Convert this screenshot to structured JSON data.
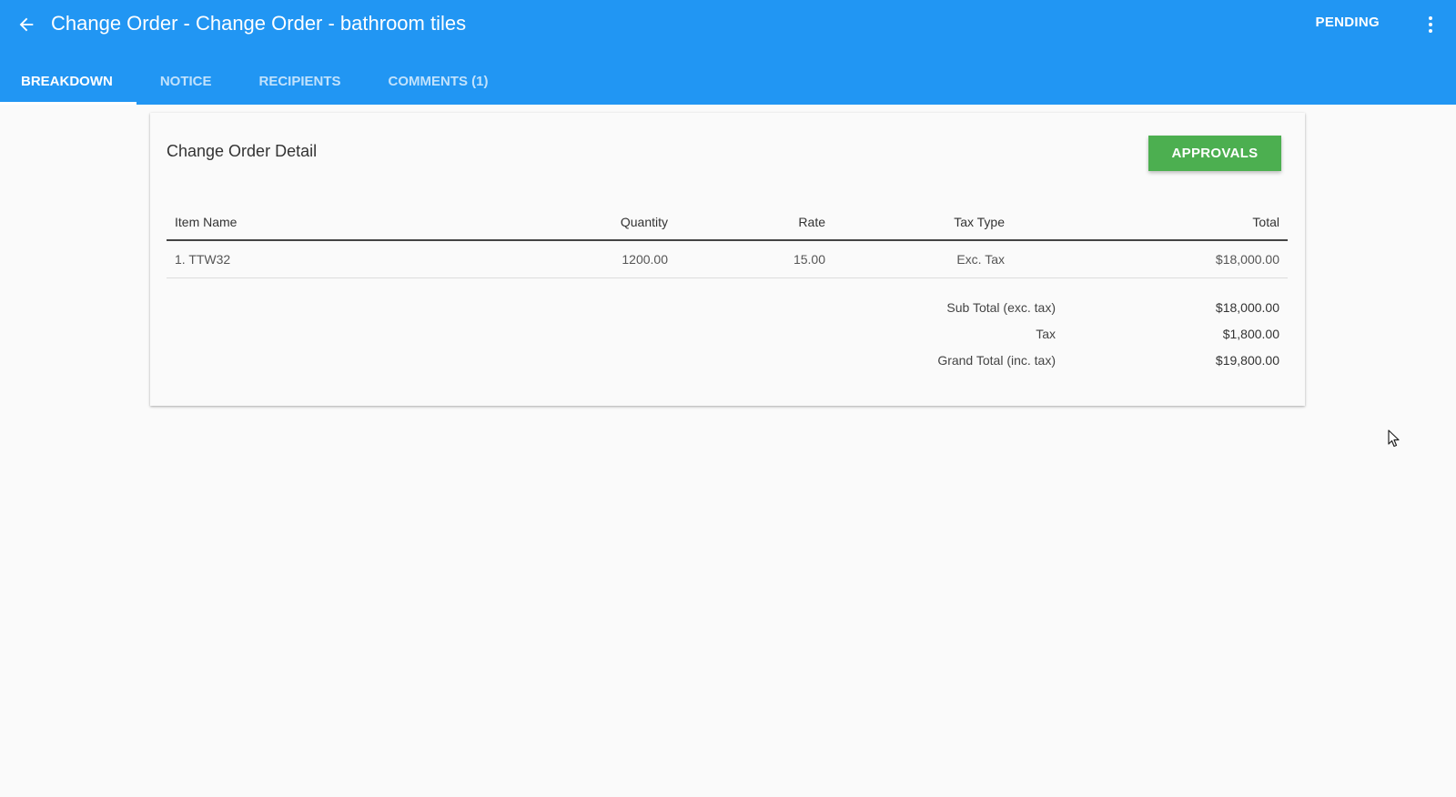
{
  "header": {
    "title": "Change Order - Change Order - bathroom tiles",
    "status": "PENDING",
    "back_icon": "arrow-left-icon",
    "menu_icon": "more-vert-icon",
    "color": "#2196f3"
  },
  "tabs": [
    {
      "label": "BREAKDOWN",
      "active": true
    },
    {
      "label": "NOTICE",
      "active": false
    },
    {
      "label": "RECIPIENTS",
      "active": false
    },
    {
      "label": "COMMENTS (1)",
      "active": false
    }
  ],
  "card": {
    "title": "Change Order Detail",
    "approvals_label": "APPROVALS",
    "approvals_color": "#4caf50"
  },
  "table": {
    "columns": [
      "Item Name",
      "Quantity",
      "Rate",
      "Tax Type",
      "Total"
    ],
    "rows": [
      {
        "name": "1. TTW32",
        "quantity": "1200.00",
        "rate": "15.00",
        "tax_type": "Exc. Tax",
        "total": "$18,000.00"
      }
    ]
  },
  "totals": [
    {
      "label": "Sub Total (exc. tax)",
      "value": "$18,000.00"
    },
    {
      "label": "Tax",
      "value": "$1,800.00"
    },
    {
      "label": "Grand Total (inc. tax)",
      "value": "$19,800.00"
    }
  ]
}
